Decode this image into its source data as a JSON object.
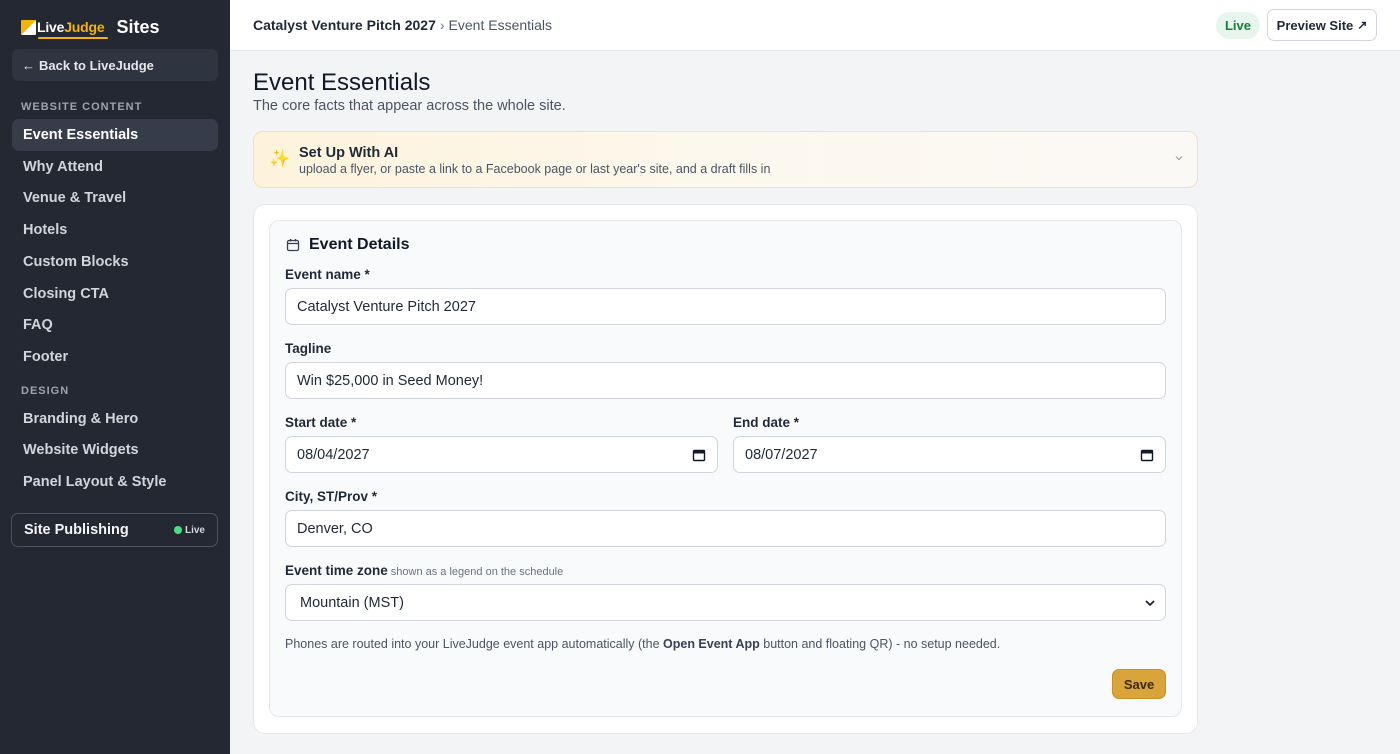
{
  "app": {
    "brand_logo_live": "Live",
    "brand_logo_judge": "Judge",
    "brand_title": "Sites",
    "back_label": "Back to LiveJudge",
    "back_arrow": "←"
  },
  "sidebar": {
    "section_content": "WEBSITE CONTENT",
    "content_items": [
      {
        "label": "Event Essentials",
        "active": true
      },
      {
        "label": "Why Attend"
      },
      {
        "label": "Venue & Travel"
      },
      {
        "label": "Hotels"
      },
      {
        "label": "Custom Blocks"
      },
      {
        "label": "Closing CTA"
      },
      {
        "label": "FAQ"
      },
      {
        "label": "Footer"
      }
    ],
    "section_design": "DESIGN",
    "design_items": [
      {
        "label": "Branding & Hero"
      },
      {
        "label": "Website Widgets"
      },
      {
        "label": "Panel Layout & Style"
      }
    ],
    "publishing": {
      "label": "Site Publishing",
      "status": "Live"
    }
  },
  "topbar": {
    "event_name": "Catalyst Venture Pitch 2027",
    "separator": "›",
    "current_page": "Event Essentials",
    "live_badge": "Live",
    "preview_label": "Preview Site",
    "preview_icon": "↗"
  },
  "main": {
    "title": "Event Essentials",
    "subtitle": "The core facts that appear across the whole site.",
    "ai_banner": {
      "icon": "✨",
      "title": "Set Up With AI",
      "description": "upload a flyer, or paste a link to a Facebook page or last year's site, and a draft fills in"
    },
    "details": {
      "heading": "Event Details",
      "event_name_label": "Event name *",
      "event_name_value": "Catalyst Venture Pitch 2027",
      "tagline_label": "Tagline",
      "tagline_value": "Win $25,000 in Seed Money!",
      "start_date_label": "Start date *",
      "start_date_value": "08/04/2027",
      "end_date_label": "End date *",
      "end_date_value": "08/07/2027",
      "city_label": "City, ST/Prov *",
      "city_value": "Denver, CO",
      "timezone_label": "Event time zone",
      "timezone_hint": "shown as a legend on the schedule",
      "timezone_value": "Mountain (MST)",
      "note_before": "Phones are routed into your LiveJudge event app automatically (the ",
      "note_strong": "Open Event App",
      "note_after": " button and floating QR) - no setup needed.",
      "save_label": "Save"
    }
  },
  "colors": {
    "sidebar_bg": "#242833",
    "accent_gold": "#d9a53a",
    "live_green": "#15803d",
    "brand_yellow": "#f5b400"
  }
}
